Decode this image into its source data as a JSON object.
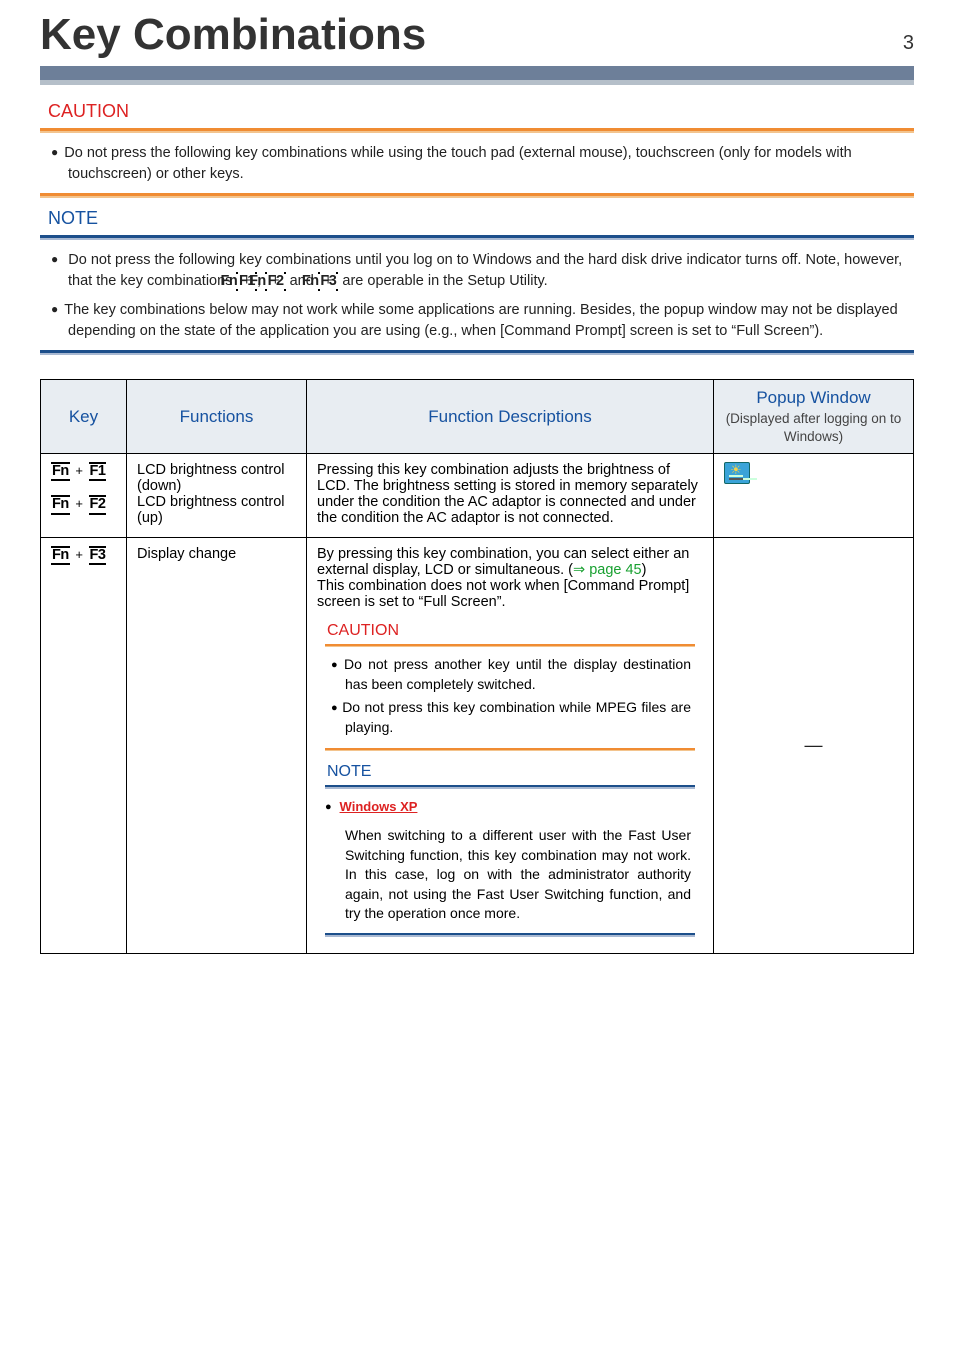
{
  "page": {
    "title": "Key Combinations",
    "number": "3"
  },
  "caution": {
    "label": "CAUTION",
    "items": [
      "Do not press the following key combinations while using the touch pad (external mouse), touchscreen (only for models with touchscreen) or other keys."
    ]
  },
  "note": {
    "label": "NOTE",
    "items": [
      {
        "pre": "Do not press the following key combinations until you log on to Windows and the hard disk drive indicator turns off. Note, however, that the key combinations ",
        "k1a": "Fn",
        "k1b": "F1",
        "k2a": "Fn",
        "k2b": "F2",
        "k3a": "Fn",
        "k3b": "F3",
        "mid1": " + ",
        "sep1": ", ",
        "mid2": " + ",
        "sep2": " and ",
        "mid3": " + ",
        "post": " are operable in the Setup Utility."
      },
      {
        "text": "The key combinations below may not work while some applications are running. Besides, the popup window may not be displayed depending on the state of the application you are using (e.g., when [Command Prompt] screen is set to “Full Screen”)."
      }
    ]
  },
  "table": {
    "headers": {
      "key": "Key",
      "functions": "Functions",
      "desc": "Function Descriptions",
      "popup": "Popup Window",
      "popup_sub": "(Displayed after logging on to Windows)"
    },
    "rows": [
      {
        "keys": [
          {
            "a": "Fn",
            "b": "F1"
          },
          {
            "a": "Fn",
            "b": "F2"
          }
        ],
        "func_lines": [
          "LCD brightness control (down)",
          "LCD brightness control (up)"
        ],
        "desc": "Pressing this key combination adjusts the brightness of LCD. The brightness setting is stored in memory separately under the condition the AC adaptor is connected and under the condition the AC adaptor is not connected.",
        "popup": "icon"
      },
      {
        "keys": [
          {
            "a": "Fn",
            "b": "F3"
          }
        ],
        "func_lines": [
          "Display change"
        ],
        "desc_pre": "By pressing this key combination, you can select either an external display, LCD or simultaneous. (",
        "desc_link_arrow": "⇒ ",
        "desc_link": "page 45",
        "desc_post": ")\nThis combination does not work when [Command Prompt] screen is set to “Full Screen”.",
        "inner_caution": {
          "label": "CAUTION",
          "items": [
            "Do not press another key until the display destination has been completely switched.",
            "Do not press this key combination while MPEG files are playing."
          ]
        },
        "inner_note": {
          "label": "NOTE",
          "winxp": "Windows XP",
          "text": "When switching to a different user with the Fast User Switching function, this key combination may not work. In this case, log on with the administrator authority again, not using the Fast User Switching function, and try the operation once more."
        },
        "popup": "dash"
      }
    ]
  }
}
